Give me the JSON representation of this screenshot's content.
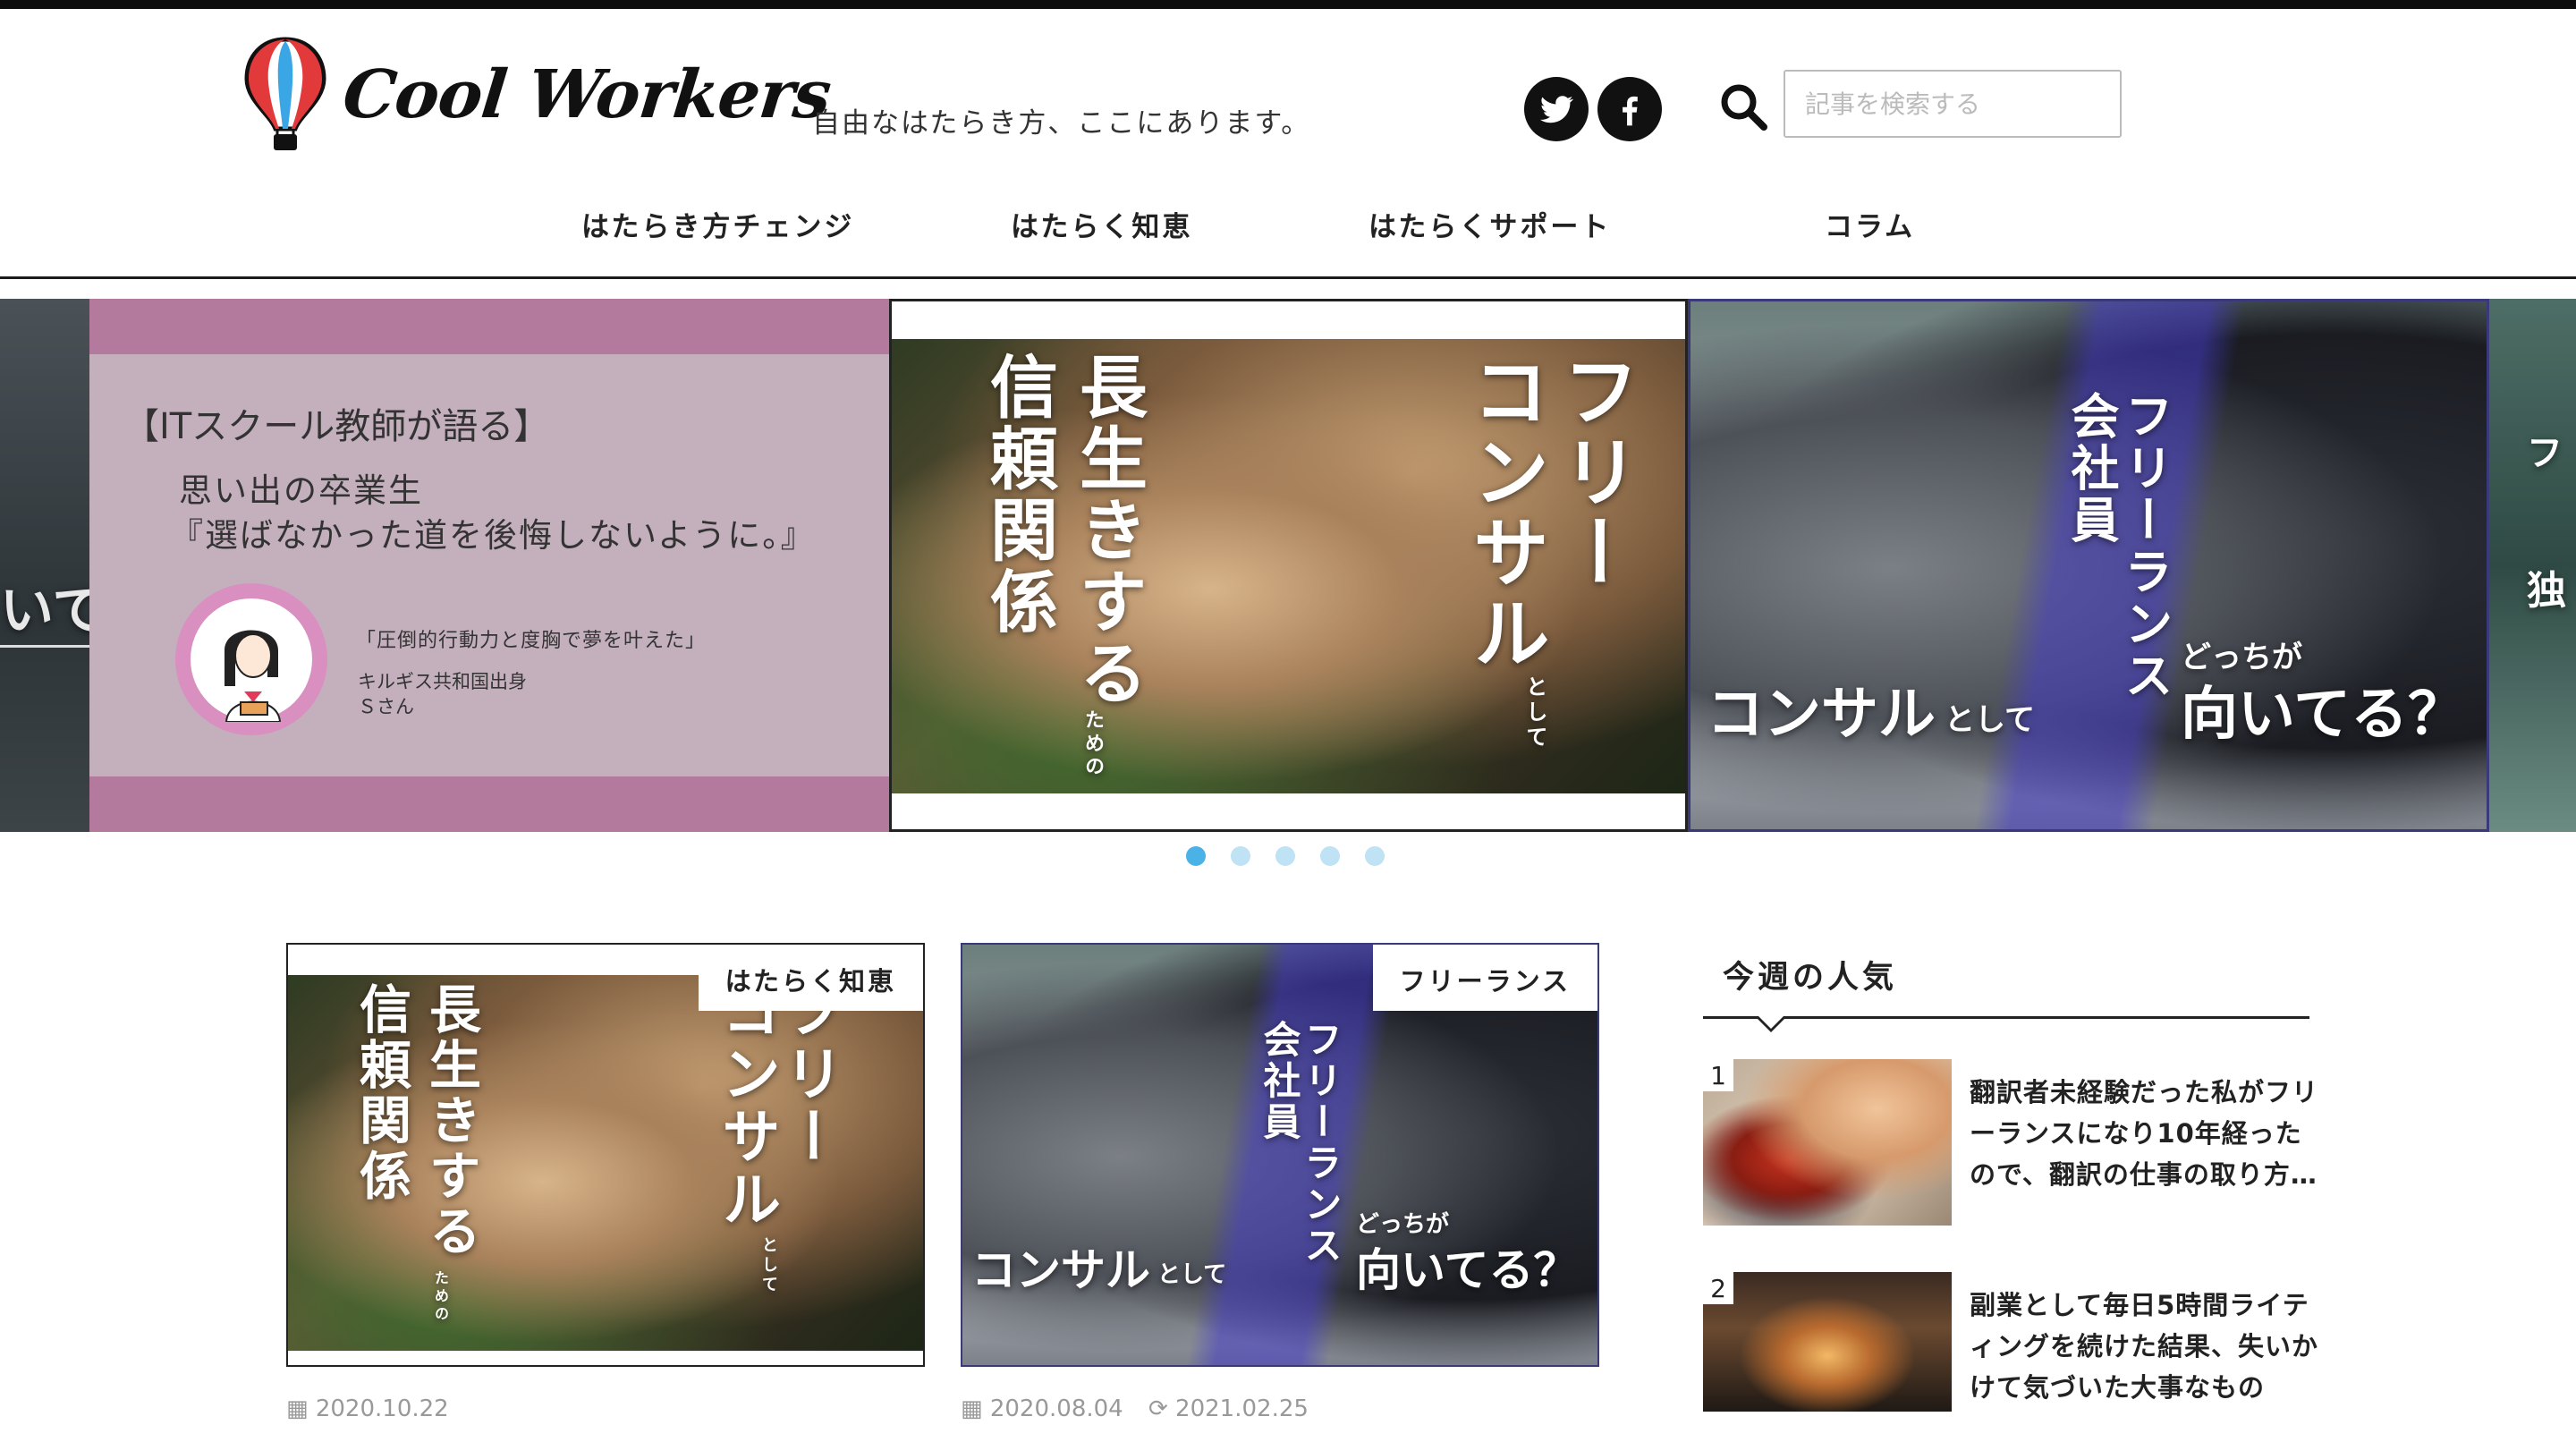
{
  "site": {
    "logo_text": "Cool Workers",
    "tagline": "自由なはたらき方、ここにあります。"
  },
  "header": {
    "search_placeholder": "記事を検索する"
  },
  "nav": {
    "items": [
      "はたらき方チェンジ",
      "はたらく知恵",
      "はたらくサポート",
      "コラム"
    ]
  },
  "slider": {
    "left_edge_text": "いて",
    "school": {
      "title": "【ITスクール教師が語る】",
      "line1": "思い出の卒業生",
      "line2": "『選ばなかった道を後悔しないように。』",
      "quote": "「圧倒的行動力と度胸で夢を叶えた」",
      "origin": "キルギス共和国出身",
      "name": "Ｓさん"
    },
    "consul": {
      "v1": "フリー",
      "v2": "コンサル",
      "v2_small": "として",
      "v3": "長生きする",
      "v3_small": "ための",
      "v4": "信頼関係"
    },
    "freelance": {
      "v1": "フリーランス",
      "v2": "会社員",
      "h1": "コンサル",
      "h1_small": "として",
      "h2_small": "どっちが",
      "h2": "向いてる？"
    },
    "right_edge": {
      "top": "フ",
      "mid": "独"
    },
    "dots": 5,
    "active_dot": 0
  },
  "cards": [
    {
      "category": "はたらく知恵",
      "date": "2020.10.22"
    },
    {
      "category": "フリーランス",
      "date": "2020.08.04",
      "updated": "2021.02.25"
    }
  ],
  "sidebar": {
    "title": "今週の人気",
    "items": [
      {
        "rank": "1",
        "title": "翻訳者未経験だった私がフリーランスになり10年経ったので、翻訳の仕事の取り方…"
      },
      {
        "rank": "2",
        "title": "副業として毎日5時間ライティングを続けた結果、失いかけて気づいた大事なもの"
      }
    ]
  },
  "colors": {
    "accent_blue": "#4bb2e8",
    "slide_pink": "#b47a9e",
    "slide_mauve": "#c4b0bd"
  }
}
